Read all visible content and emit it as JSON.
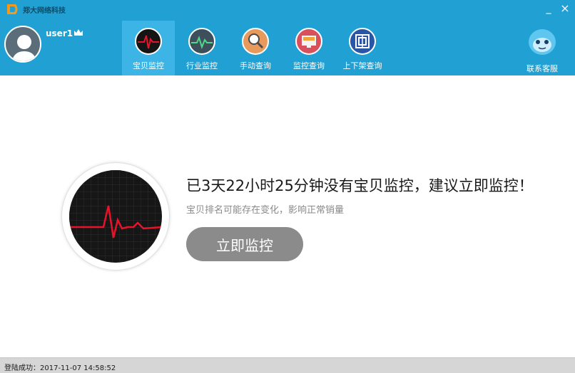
{
  "app": {
    "title": "郑大网络科技"
  },
  "window": {
    "minimize": "_",
    "close": "×"
  },
  "user": {
    "name": "user1"
  },
  "tabs": [
    {
      "label": "宝贝监控",
      "active": true
    },
    {
      "label": "行业监控",
      "active": false
    },
    {
      "label": "手动查询",
      "active": false
    },
    {
      "label": "监控查询",
      "active": false
    },
    {
      "label": "上下架查询",
      "active": false
    }
  ],
  "support": {
    "label": "联系客服"
  },
  "main": {
    "title": "已3天22小时25分钟没有宝贝监控，建议立即监控！",
    "subtitle": "宝贝排名可能存在变化，影响正常销量",
    "button": "立即监控"
  },
  "status": {
    "text": "登陆成功：2017-11-07 14:58:52"
  },
  "colors": {
    "header": "#20a0d3",
    "active_tab": "#3cb4e6",
    "button": "#8b8b8b",
    "pulse": "#e8132b"
  }
}
